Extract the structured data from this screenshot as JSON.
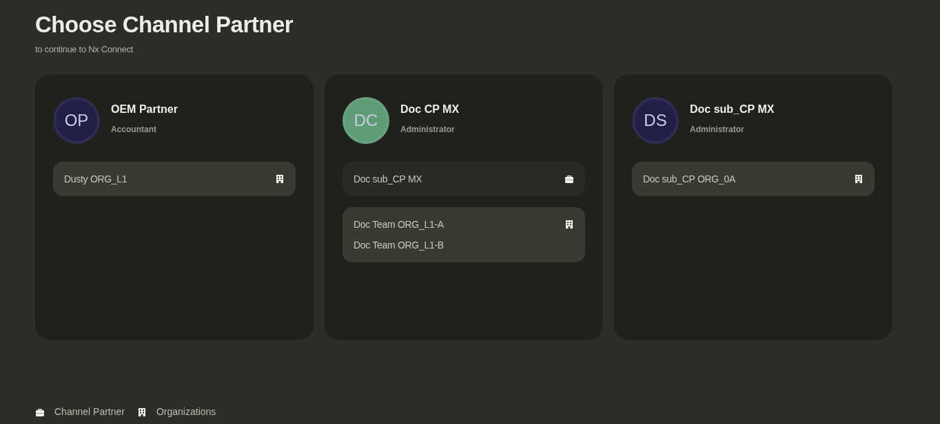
{
  "title": "Choose Channel Partner",
  "subtitle": "to continue to Nx Connect",
  "partners": [
    {
      "initials": "OP",
      "color": "#222048",
      "name": "OEM Partner",
      "role": "Accountant",
      "groups": [
        {
          "kind": "organization",
          "items": [
            "Dusty ORG_L1"
          ]
        }
      ]
    },
    {
      "initials": "DC",
      "color": "#5e9c78",
      "name": "Doc CP MX",
      "role": "Administrator",
      "groups": [
        {
          "kind": "channel_partner",
          "items": [
            "Doc sub_CP MX"
          ]
        },
        {
          "kind": "organization",
          "items": [
            "Doc Team ORG_L1-A",
            "Doc Team ORG_L1-B"
          ]
        }
      ]
    },
    {
      "initials": "DS",
      "color": "#222048",
      "name": "Doc sub_CP MX",
      "role": "Administrator",
      "groups": [
        {
          "kind": "organization",
          "items": [
            "Doc sub_CP ORG_0A"
          ]
        }
      ]
    }
  ],
  "legend": [
    {
      "kind": "channel_partner",
      "label": "Channel Partner"
    },
    {
      "kind": "organization",
      "label": "Organizations"
    }
  ]
}
